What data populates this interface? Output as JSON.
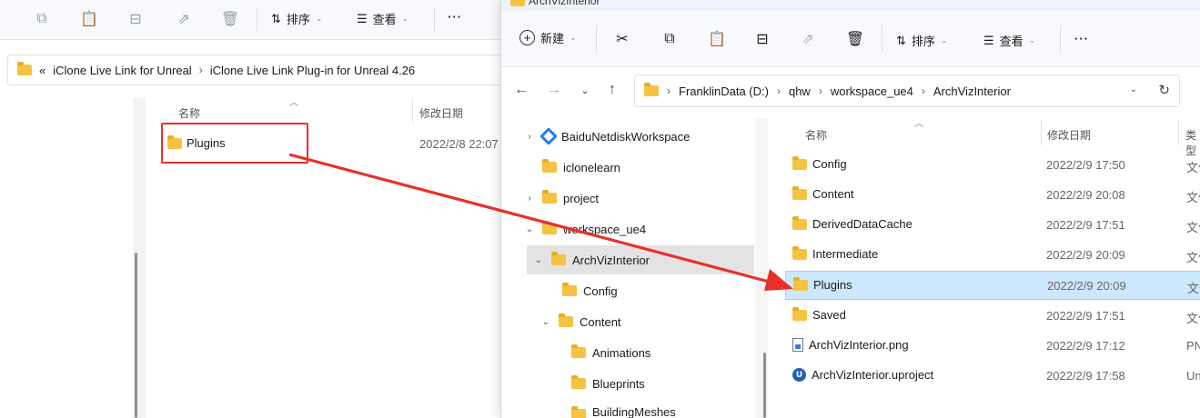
{
  "left_window": {
    "toolbar": {
      "sort_label": "排序",
      "view_label": "查看",
      "more_label": "···"
    },
    "address": {
      "overflow": "«",
      "crumbs": [
        "iClone Live Link for Unreal",
        "iClone Live Link Plug-in for Unreal 4.26"
      ]
    },
    "columns": {
      "name": "名称",
      "date": "修改日期"
    },
    "rows": [
      {
        "name": "Plugins",
        "date": "2022/2/8 22:07"
      }
    ]
  },
  "right_window": {
    "title": "ArchVizInterior",
    "toolbar": {
      "new_label": "新建",
      "sort_label": "排序",
      "view_label": "查看",
      "more_label": "···"
    },
    "address": {
      "crumbs": [
        "FranklinData (D:)",
        "qhw",
        "workspace_ue4",
        "ArchVizInterior"
      ]
    },
    "tree": [
      {
        "label": "BaiduNetdiskWorkspace",
        "expander": "›",
        "icon": "baidu-icon"
      },
      {
        "label": "iclonelearn",
        "expander": "",
        "icon": "folder-icon"
      },
      {
        "label": "project",
        "expander": "›",
        "icon": "folder-icon"
      },
      {
        "label": "workspace_ue4",
        "expander": "⌄",
        "icon": "folder-icon"
      },
      {
        "label": "ArchVizInterior",
        "expander": "⌄",
        "icon": "folder-icon",
        "selected": true
      },
      {
        "label": "Config",
        "expander": "",
        "icon": "folder-icon"
      },
      {
        "label": "Content",
        "expander": "⌄",
        "icon": "folder-icon"
      },
      {
        "label": "Animations",
        "expander": "",
        "icon": "folder-icon"
      },
      {
        "label": "Blueprints",
        "expander": "",
        "icon": "folder-icon"
      },
      {
        "label": "BuildingMeshes",
        "expander": "",
        "icon": "folder-icon"
      }
    ],
    "columns": {
      "name": "名称",
      "date": "修改日期",
      "type": "类型"
    },
    "files": [
      {
        "name": "Config",
        "date": "2022/2/9 17:50",
        "type": "文件夹",
        "icon": "folder-icon"
      },
      {
        "name": "Content",
        "date": "2022/2/9 20:08",
        "type": "文件夹",
        "icon": "folder-icon"
      },
      {
        "name": "DerivedDataCache",
        "date": "2022/2/9 17:51",
        "type": "文件夹",
        "icon": "folder-icon"
      },
      {
        "name": "Intermediate",
        "date": "2022/2/9 20:09",
        "type": "文件夹",
        "icon": "folder-icon"
      },
      {
        "name": "Plugins",
        "date": "2022/2/9 20:09",
        "type": "文件夹",
        "icon": "folder-icon",
        "selected": true
      },
      {
        "name": "Saved",
        "date": "2022/2/9 17:51",
        "type": "文件夹",
        "icon": "folder-icon"
      },
      {
        "name": "ArchVizInterior.png",
        "date": "2022/2/9 17:12",
        "type": "PNG",
        "icon": "png-file-icon"
      },
      {
        "name": "ArchVizInterior.uproject",
        "date": "2022/2/9 17:58",
        "type": "Un",
        "icon": "unreal-project-icon"
      }
    ]
  },
  "annotation": {
    "highlight_color": "#e8302b",
    "selection_color": "#cce8ff"
  }
}
